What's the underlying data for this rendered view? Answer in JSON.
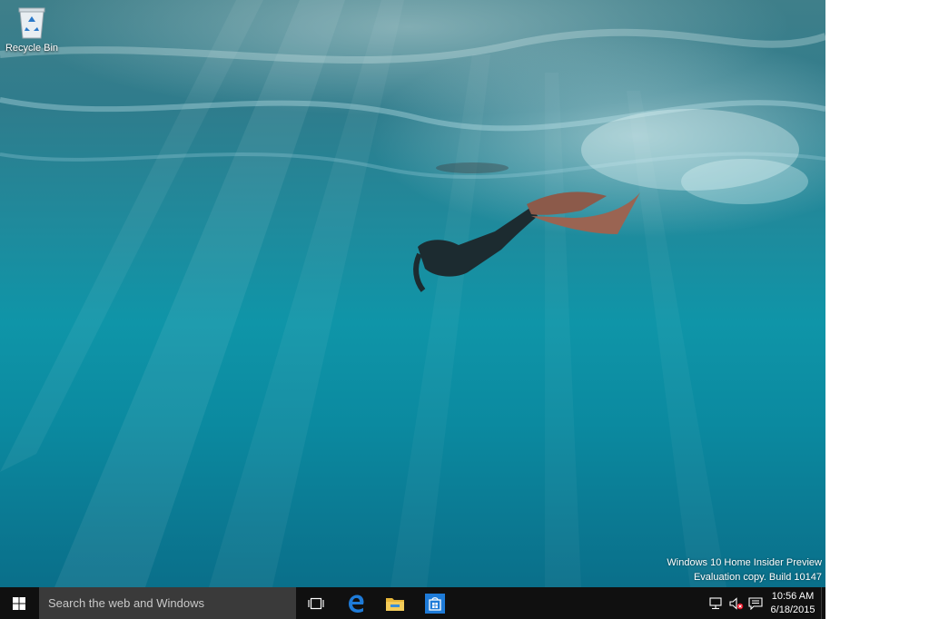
{
  "desktop": {
    "icons": [
      {
        "label": "Recycle Bin",
        "icon": "recycle-bin-icon"
      }
    ],
    "watermark": {
      "line1": "Windows 10 Home Insider Preview",
      "line2": "Evaluation copy. Build 10147"
    }
  },
  "taskbar": {
    "start_icon": "windows-logo-icon",
    "search_placeholder": "Search the web and Windows",
    "pinned": [
      {
        "name": "Task View",
        "icon": "task-view-icon"
      },
      {
        "name": "Microsoft Edge",
        "icon": "edge-icon"
      },
      {
        "name": "File Explorer",
        "icon": "file-explorer-icon"
      },
      {
        "name": "Store",
        "icon": "store-icon"
      }
    ],
    "tray": {
      "icons": [
        "network-icon",
        "volume-muted-icon",
        "action-center-icon"
      ],
      "time": "10:56 AM",
      "date": "6/18/2015"
    },
    "colors": {
      "taskbar_bg": "#101010",
      "search_bg": "#3a3a3a",
      "accent": "#1e7bd8",
      "muted_badge": "#e81123"
    }
  }
}
